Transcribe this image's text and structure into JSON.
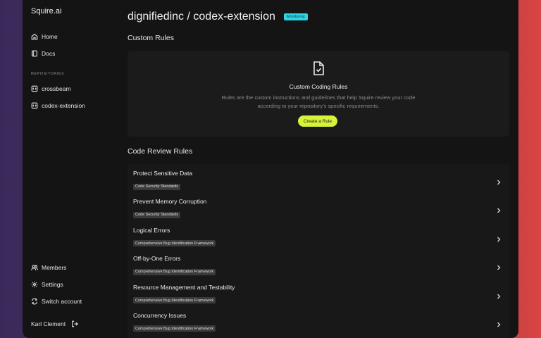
{
  "sidebar": {
    "brand": "Squire.ai",
    "nav": [
      {
        "label": "Home",
        "icon": "home-icon"
      },
      {
        "label": "Docs",
        "icon": "book-icon"
      }
    ],
    "repositories_label": "REPOSITORIES",
    "repositories": [
      {
        "label": "crossbeam",
        "icon": "repo-icon"
      },
      {
        "label": "codex-extension",
        "icon": "repo-icon"
      }
    ],
    "bottom": [
      {
        "label": "Members",
        "icon": "users-icon"
      },
      {
        "label": "Settings",
        "icon": "gear-icon"
      },
      {
        "label": "Switch account",
        "icon": "switch-icon"
      }
    ],
    "user": {
      "name": "Karl Clement",
      "icon": "logout-icon"
    }
  },
  "header": {
    "title": "dignifiedinc / codex-extension",
    "badge": "Monitoring",
    "badge_color": "#2fd3e6"
  },
  "custom_rules": {
    "title": "Custom Rules",
    "empty_title": "Custom Coding Rules",
    "empty_description": "Rules are the custom instructions and guidelines that help Squire review your code according to your repository's specific requirements.",
    "create_label": "Create a Rule",
    "accent": "#d6f23a"
  },
  "code_review_rules": {
    "title": "Code Review Rules",
    "items": [
      {
        "name": "Protect Sensitive Data",
        "tag": "Code Security Standards"
      },
      {
        "name": "Prevent Memory Corruption",
        "tag": "Code Security Standards"
      },
      {
        "name": "Logical Errors",
        "tag": "Comprehensive Bug Identification Framework"
      },
      {
        "name": "Off-by-One Errors",
        "tag": "Comprehensive Bug Identification Framework"
      },
      {
        "name": "Resource Management and Testability",
        "tag": "Comprehensive Bug Identification Framework"
      },
      {
        "name": "Concurrency Issues",
        "tag": "Comprehensive Bug Identification Framework"
      }
    ]
  }
}
